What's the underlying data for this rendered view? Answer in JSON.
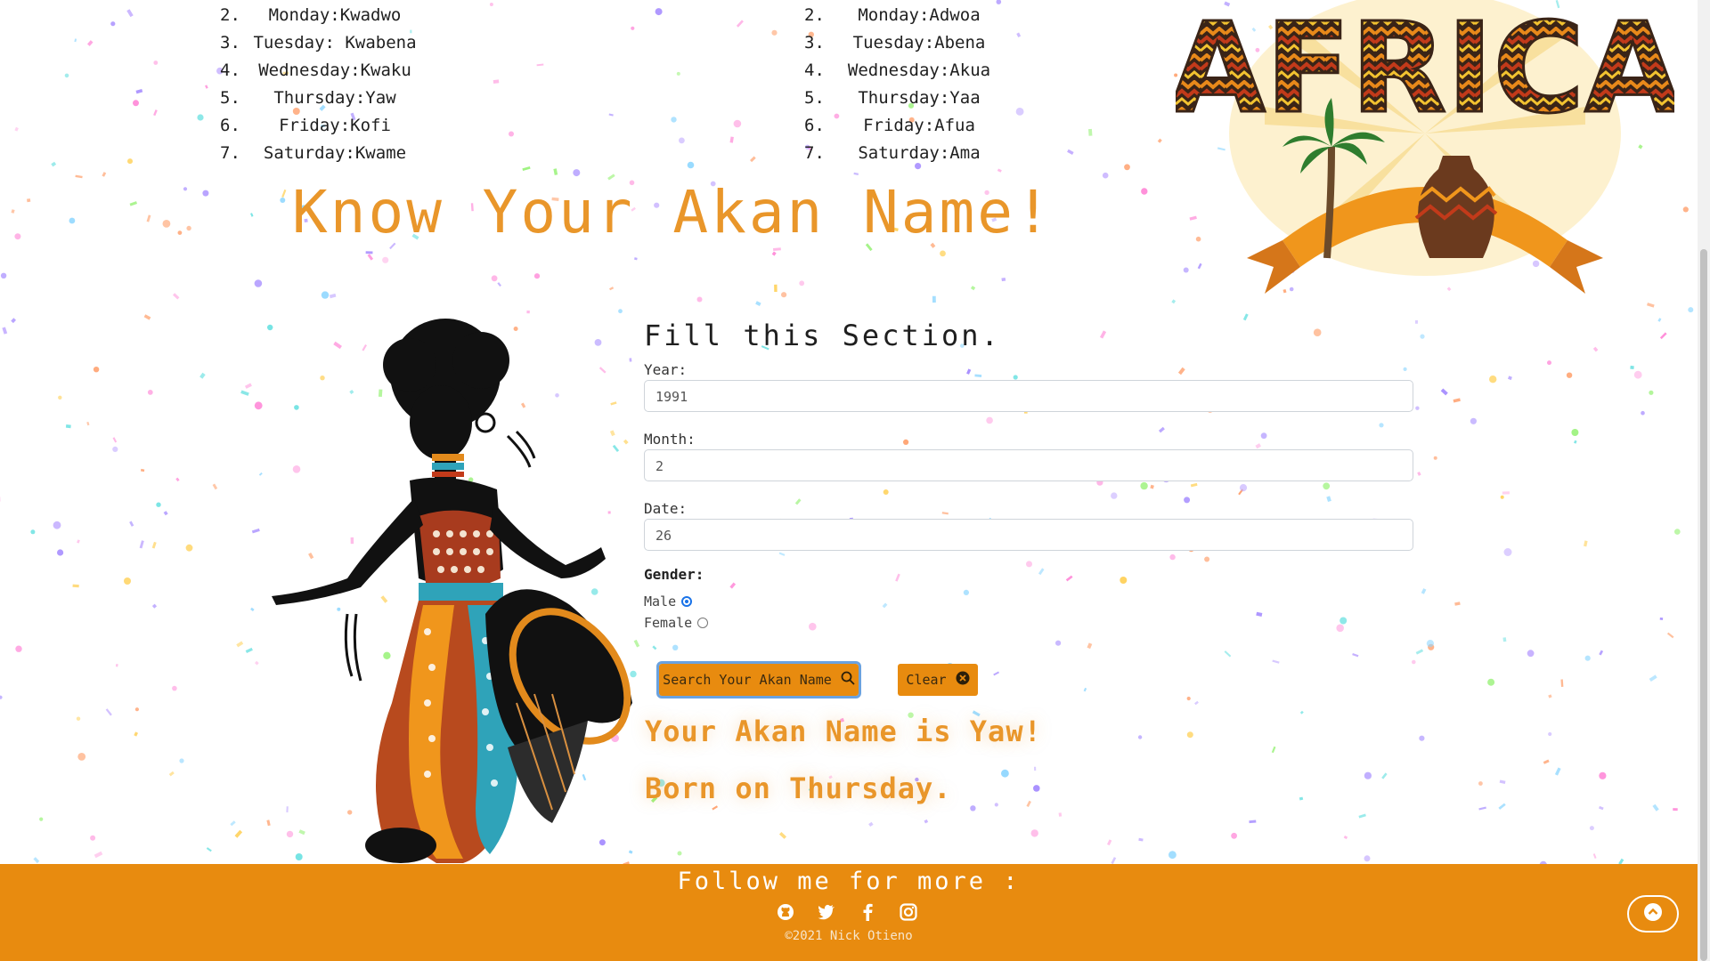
{
  "male_names": [
    {
      "num": "2.",
      "text": "Monday:Kwadwo"
    },
    {
      "num": "3.",
      "text": "Tuesday: Kwabena"
    },
    {
      "num": "4.",
      "text": "Wednesday:Kwaku"
    },
    {
      "num": "5.",
      "text": "Thursday:Yaw"
    },
    {
      "num": "6.",
      "text": "Friday:Kofi"
    },
    {
      "num": "7.",
      "text": "Saturday:Kwame"
    }
  ],
  "female_names": [
    {
      "num": "2.",
      "text": "Monday:Adwoa"
    },
    {
      "num": "3.",
      "text": "Tuesday:Abena"
    },
    {
      "num": "4.",
      "text": "Wednesday:Akua"
    },
    {
      "num": "5.",
      "text": "Thursday:Yaa"
    },
    {
      "num": "6.",
      "text": "Friday:Afua"
    },
    {
      "num": "7.",
      "text": "Saturday:Ama"
    }
  ],
  "page_title": "Know Your Akan Name!",
  "logo_text": "AFRICA",
  "form": {
    "title": "Fill this Section.",
    "year_label": "Year:",
    "year_value": "1991",
    "month_label": "Month:",
    "month_value": "2",
    "date_label": "Date:",
    "date_value": "26",
    "gender_label": "Gender:",
    "male_label": "Male",
    "female_label": "Female",
    "selected_gender": "Male",
    "search_label": "Search Your Akan Name",
    "clear_label": "Clear"
  },
  "result": {
    "name_line": "Your Akan Name is Yaw!",
    "day_line": "Born on Thursday."
  },
  "footer": {
    "follow": "Follow me for more :",
    "copyright": "©2021 Nick Otieno",
    "socials": [
      "github-icon",
      "twitter-icon",
      "facebook-icon",
      "instagram-icon"
    ]
  },
  "colors": {
    "accent": "#e88b0f",
    "title": "#e9962a",
    "radio_checked": "#1a73e8"
  }
}
